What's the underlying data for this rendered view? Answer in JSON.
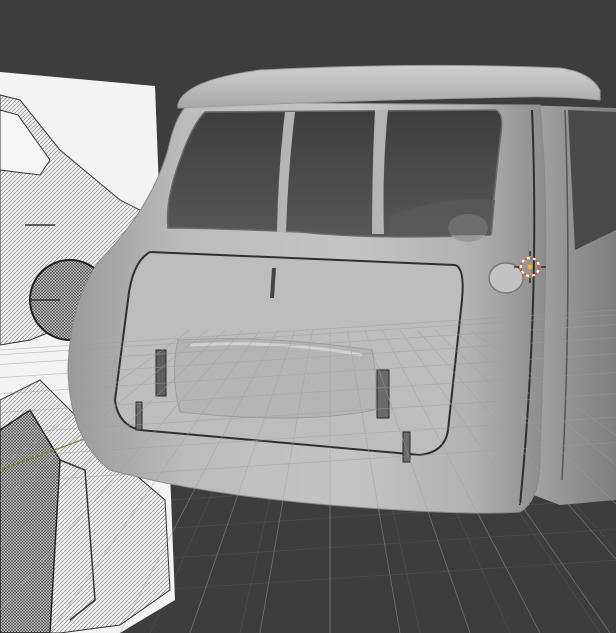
{
  "scene": {
    "kind": "3d-viewport",
    "subject": "car-rear-body-model",
    "colors": {
      "background": "#3d3d3d",
      "grid": "#4a4a4a",
      "x_axis": "#8a3d3d",
      "y_axis": "#5f8a2a",
      "body": "#b9b9b9",
      "glass": "#4e4e4e",
      "reference_paper": "#f2f2f2",
      "cursor": "#e05a2a"
    },
    "icons": [
      "3d-cursor-icon"
    ]
  }
}
